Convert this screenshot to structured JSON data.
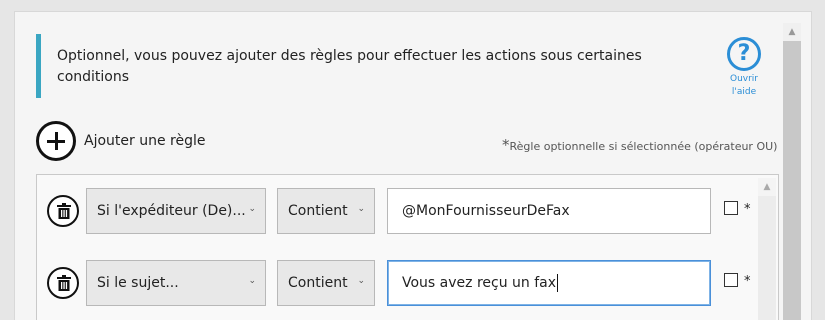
{
  "info": {
    "text": "Optionnel, vous pouvez ajouter des règles pour effectuer les actions sous certaines conditions"
  },
  "help": {
    "glyph": "?",
    "line1": "Ouvrir",
    "line2": "l'aide"
  },
  "add_rule": {
    "label": "Ajouter une règle"
  },
  "optional_note": {
    "star": "*",
    "text": "Règle optionnelle si sélectionnée (opérateur OU)"
  },
  "rules": [
    {
      "condition": "Si l'expéditeur (De)...",
      "operator": "Contient",
      "value": "@MonFournisseurDeFax",
      "optional_checked": false,
      "star": "*"
    },
    {
      "condition": "Si le sujet...",
      "operator": "Contient",
      "value": "Vous avez reçu un fax",
      "optional_checked": false,
      "star": "*"
    }
  ],
  "colors": {
    "accent": "#3aa6c2",
    "help_blue": "#2b8ed6",
    "focus_border": "#4a90d9"
  },
  "icons": {
    "chevron": "chevron-down-icon",
    "help": "help-circle-icon",
    "add": "plus-circle-icon",
    "delete": "trash-icon"
  }
}
